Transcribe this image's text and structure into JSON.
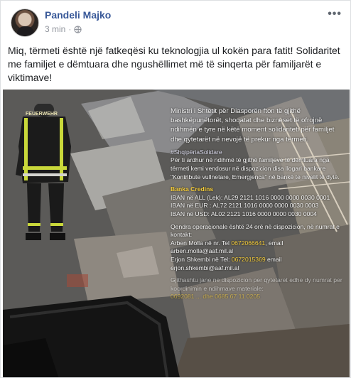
{
  "post": {
    "author": "Pandeli Majko",
    "time": "3 min",
    "time_separator": "·",
    "privacy_icon": "globe-icon",
    "more_icon": "more-options-icon",
    "more_label": "•••",
    "caption": "Miq, tërmeti është një fatkeqësi ku teknologjia ul kokën para fatit! Solidaritet me familjet e dëmtuara dhe ngushëllimet më të sinqerta për familjarët e viktimave!"
  },
  "photo": {
    "firefighter_label": "FEUERWEHR",
    "lead": "Ministri i Shtetit për Diasporën fton të gjithë bashkëpunëtorët, shoqatat dhe bizneset të ofrojnë ndihmën e tyre në këtë moment solidariteti për familjet dhe qytetarët në nevojë të prekur nga tërmeti.",
    "hashtag": "#ShqipëriaSolidare",
    "hashtag_body": "Për ti ardhur në ndihmë të gjithë familjeve të dëmtuara nga tërmeti kemi vendosur në dispozicion disa llogari bankare \"Kontribute vullnetare, Emergjenca\" në bankë te nivelit të dytë.",
    "bank_title": "Banka Credins",
    "iban_all": "IBAN në ALL (Lek):        AL29 2121 1016 0000 0000 0030 0001",
    "iban_eur": "IBAN në EUR : AL72 2121 1016 0000 0000 0030 0003",
    "iban_usd": "IBAN në USD: AL02 2121 1016 0000 0000 0030 0004",
    "center": "Qendra operacionale është 24 orë në dispozicion, në numrat e kontakt:",
    "contact1_name": "Arben Molla në nr. Tel",
    "contact1_phone": "0672066641",
    "contact1_tail": ", email",
    "contact1_email": "arben.molla@aaf.mil.al",
    "contact2_name": "Erjon Shkembi në  Tel:",
    "contact2_phone": "0672015369",
    "contact2_tail": " email",
    "contact2_email": "erjon.shkembi@aaf.mil.al",
    "footer": "Gjithashtu jane ne dispozicion per qytetaret edhe dy numrat per koordinimin e ndihmave materiale:",
    "footer_phones": "0692081 ... dhe 0685 67 11 0205"
  }
}
